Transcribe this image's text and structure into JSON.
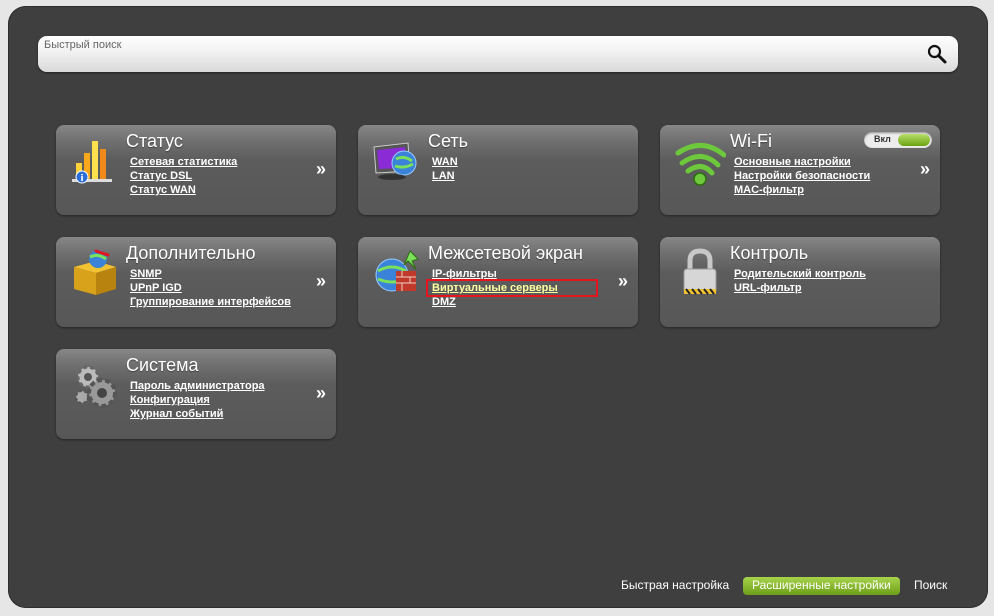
{
  "search": {
    "placeholder": "Быстрый поиск"
  },
  "cards": {
    "status": {
      "title": "Статус",
      "links": [
        "Сетевая статистика",
        "Статус DSL",
        "Статус WAN"
      ],
      "arrow": "»"
    },
    "network": {
      "title": "Сеть",
      "links": [
        "WAN",
        "LAN"
      ],
      "arrow": "»"
    },
    "wifi": {
      "title": "Wi-Fi",
      "toggle_label": "Вкл",
      "links": [
        "Основные настройки",
        "Настройки безопасности",
        "MAC-фильтр"
      ],
      "arrow": "»"
    },
    "advanced": {
      "title": "Дополнительно",
      "links": [
        "SNMP",
        "UPnP IGD",
        "Группирование интерфейсов"
      ],
      "arrow": "»"
    },
    "firewall": {
      "title": "Межсетевой экран",
      "links": [
        "IP-фильтры",
        "Виртуальные серверы",
        "DMZ"
      ],
      "arrow": "»"
    },
    "control": {
      "title": "Контроль",
      "links": [
        "Родительский контроль",
        "URL-фильтр"
      ],
      "arrow": "»"
    },
    "system": {
      "title": "Система",
      "links": [
        "Пароль администратора",
        "Конфигурация",
        "Журнал событий"
      ],
      "arrow": "»"
    }
  },
  "bottom_nav": {
    "quick_setup": "Быстрая настройка",
    "advanced_settings": "Расширенные настройки",
    "search": "Поиск"
  },
  "colors": {
    "background": "#3f3f3f",
    "card": "#5c5c5c",
    "accent_green": "#8cbd2f",
    "highlight_red": "#e8141b"
  },
  "icons": [
    "search-icon",
    "bar-chart-icon",
    "monitor-globe-icon",
    "wifi-icon",
    "box-icon",
    "globe-firewall-icon",
    "padlock-icon",
    "gears-icon"
  ]
}
